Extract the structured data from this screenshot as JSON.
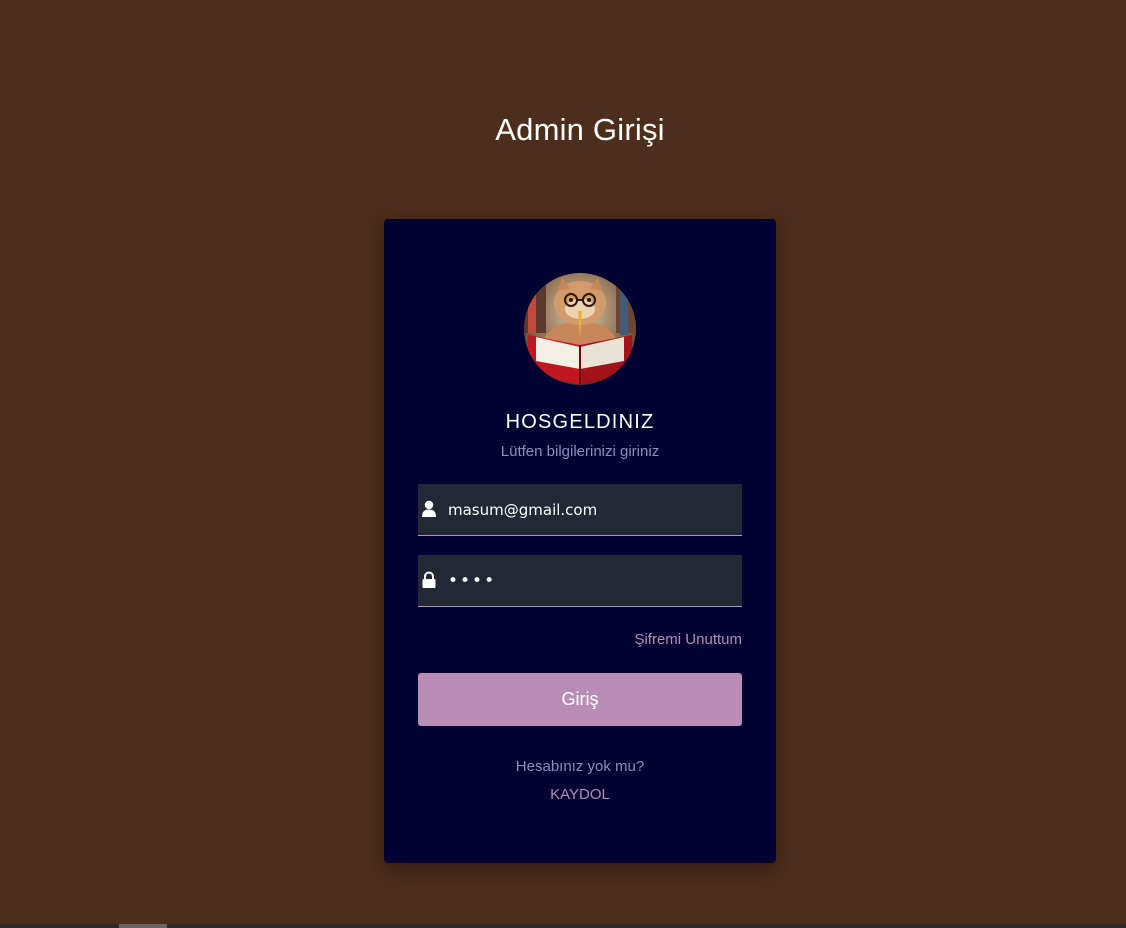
{
  "page": {
    "title": "Admin Girişi"
  },
  "card": {
    "welcome": "HOSGELDINIZ",
    "subtitle": "Lütfen bilgilerinizi giriniz",
    "email": {
      "value": "masum@gmail.com",
      "icon": "user-icon"
    },
    "password": {
      "value": "••••",
      "icon": "lock-icon"
    },
    "forgot_label": "Şifremi Unuttum",
    "login_label": "Giriş",
    "no_account_text": "Hesabınız yok mu?",
    "register_label": "KAYDOL"
  },
  "colors": {
    "background": "#4d2d1c",
    "card": "#010232",
    "accent": "#b98cb6",
    "input_bg": "#222834",
    "muted_text": "#8f8fb5"
  }
}
